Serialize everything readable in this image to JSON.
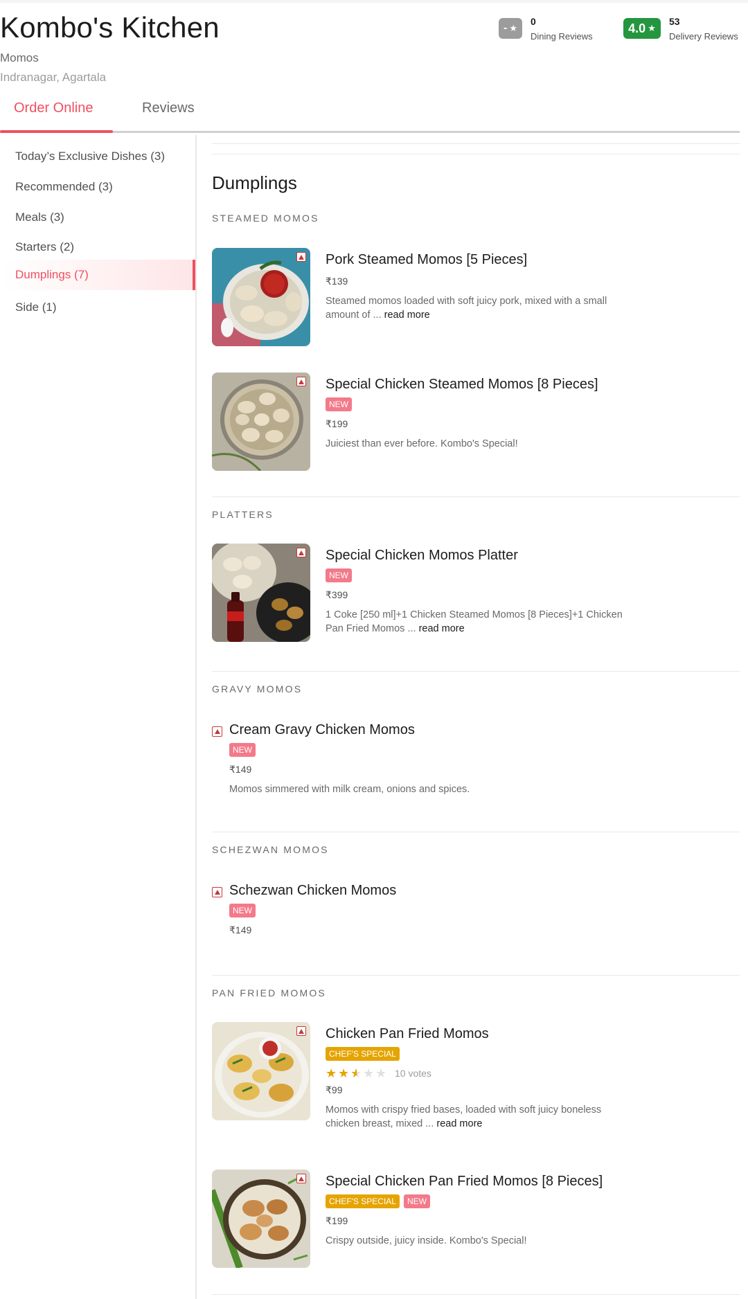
{
  "restaurant": {
    "name": "Kombo's Kitchen",
    "cuisine": "Momos",
    "locality": "Indranagar, Agartala"
  },
  "ratings": {
    "dining": {
      "value": "-",
      "count": "0",
      "label": "Dining Reviews",
      "color": "#9c9c9c"
    },
    "delivery": {
      "value": "4.0",
      "count": "53",
      "label": "Delivery Reviews",
      "color": "#24963f"
    }
  },
  "tabs": [
    {
      "label": "Order Online",
      "active": true
    },
    {
      "label": "Reviews",
      "active": false
    }
  ],
  "sidebar": {
    "items": [
      {
        "label": "Today’s Exclusive Dishes (3)"
      },
      {
        "label": "Recommended (3)"
      },
      {
        "label": "Meals (3)"
      },
      {
        "label": "Starters (2)"
      },
      {
        "label": "Dumplings (7)",
        "active": true
      },
      {
        "label": "Side (1)"
      }
    ]
  },
  "menu": {
    "section_title": "Dumplings",
    "subsections": [
      {
        "title": "STEAMED MOMOS"
      },
      {
        "title": "PLATTERS"
      },
      {
        "title": "GRAVY MOMOS"
      },
      {
        "title": "SCHEZWAN MOMOS"
      },
      {
        "title": "PAN FRIED MOMOS"
      }
    ],
    "items": [
      {
        "name": "Pork Steamed Momos [5 Pieces]",
        "price": "₹139",
        "description": "Steamed momos loaded with soft juicy pork, mixed with a small amount of ... ",
        "read_more": "read more",
        "icon": "non-veg-icon"
      },
      {
        "name": "Special Chicken Steamed Momos [8 Pieces]",
        "tags": [
          "NEW"
        ],
        "price": "₹199",
        "description": "Juiciest than ever before. Kombo's Special!",
        "icon": "non-veg-icon"
      },
      {
        "name": "Special Chicken Momos Platter",
        "tags": [
          "NEW"
        ],
        "price": "₹399",
        "description": "1 Coke [250 ml]+1 Chicken Steamed Momos [8 Pieces]+1 Chicken Pan Fried Momos ... ",
        "read_more": "read more",
        "icon": "non-veg-icon"
      },
      {
        "name": "Cream Gravy Chicken Momos",
        "tags": [
          "NEW"
        ],
        "price": "₹149",
        "description": "Momos simmered with milk cream, onions and spices.",
        "icon": "non-veg-icon"
      },
      {
        "name": "Schezwan Chicken Momos",
        "tags": [
          "NEW"
        ],
        "price": "₹149",
        "icon": "non-veg-icon"
      },
      {
        "name": "Chicken Pan Fried Momos",
        "tags": [
          "CHEF'S SPECIAL"
        ],
        "rating_stars": 2.5,
        "votes": "10 votes",
        "price": "₹99",
        "description": "Momos with crispy fried bases, loaded with soft juicy boneless chicken breast, mixed ... ",
        "read_more": "read more",
        "icon": "non-veg-icon"
      },
      {
        "name": "Special Chicken Pan Fried Momos [8 Pieces]",
        "tags": [
          "CHEF'S SPECIAL",
          "NEW"
        ],
        "price": "₹199",
        "description": "Crispy outside, juicy inside. Kombo's Special!",
        "icon": "non-veg-icon"
      }
    ]
  },
  "colors": {
    "accent": "#ef4f5f",
    "new_tag": "#f37a8a",
    "chef_tag": "#e5a400",
    "nonveg": "#c23b3b"
  }
}
